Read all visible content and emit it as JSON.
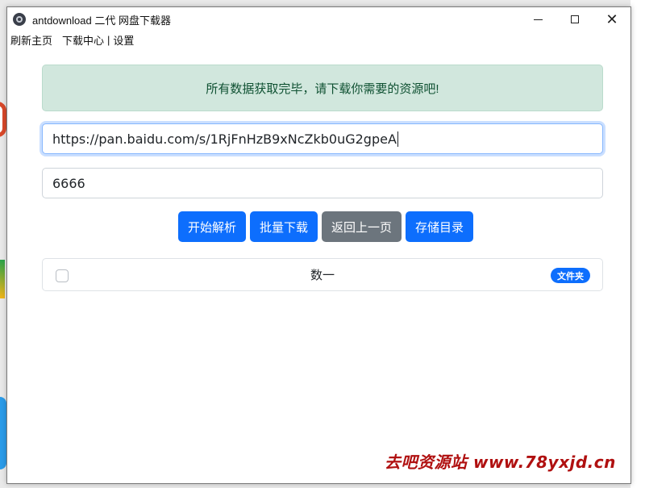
{
  "window": {
    "title": "antdownload 二代 网盘下载器",
    "controls": {
      "minimize": "",
      "maximize": "",
      "close": "✕"
    }
  },
  "menu": {
    "refresh_home": "刷新主页",
    "download_center": "下载中心",
    "separator": "|",
    "settings": "设置"
  },
  "alert": {
    "text": "所有数据获取完毕，请下载你需要的资源吧!"
  },
  "inputs": {
    "share_url": "https://pan.baidu.com/s/1RjFnHzB9xNcZkb0uG2gpeA",
    "extract_code": "6666"
  },
  "buttons": {
    "parse": "开始解析",
    "batch_download": "批量下载",
    "back": "返回上一页",
    "storage_dir": "存储目录"
  },
  "file_list": [
    {
      "name": "数一",
      "type_badge": "文件夹",
      "checked": false
    }
  ],
  "watermark": "去吧资源站 www.78yxjd.cn",
  "colors": {
    "primary": "#0d6efd",
    "secondary": "#6c757d",
    "alert_bg": "#d1e7dd",
    "alert_text": "#0f5132",
    "watermark": "#b01010"
  }
}
